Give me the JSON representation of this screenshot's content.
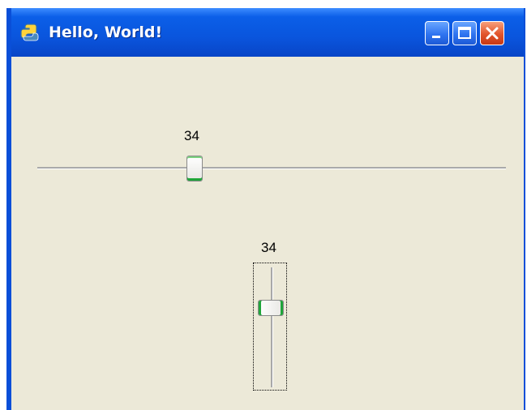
{
  "window": {
    "title": "Hello, World!",
    "icon": "python-icon",
    "controls": [
      "minimize-icon",
      "maximize-icon",
      "close-icon"
    ]
  },
  "sliders": {
    "horizontal": {
      "value": "34",
      "min": 0,
      "max": 100
    },
    "vertical": {
      "value": "34",
      "min": 0,
      "max": 100,
      "focused": true
    }
  },
  "colors": {
    "titlebar": "#0a55dd",
    "client": "#ece9d8",
    "close_button": "#e2542b",
    "thumb_accent": "#1fa53a"
  }
}
